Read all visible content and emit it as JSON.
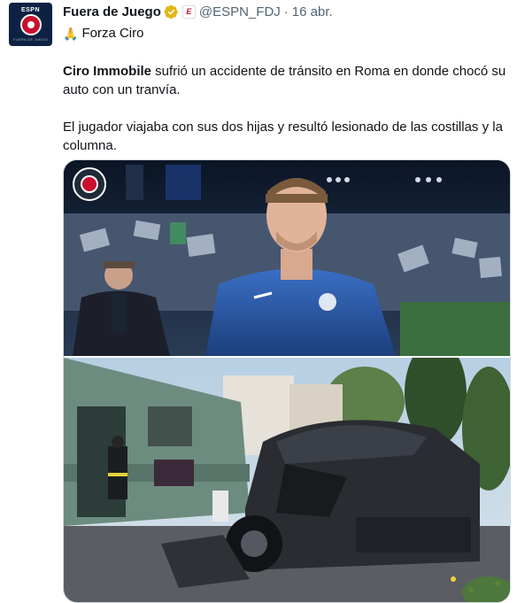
{
  "author": {
    "name": "Fuera de Juego",
    "handle": "@ESPN_FDJ",
    "separator": "·",
    "date": "16 abr.",
    "avatar_text": "ESPN",
    "avatar_subtext": "FUERA DE JUEGO",
    "affiliate_icon": "espn-e-badge-icon",
    "verified_icon": "verified-gold-badge-icon"
  },
  "tweet": {
    "first_line_emoji": "🙏",
    "first_line_text": "Forza Ciro",
    "paragraph1_bold": "Ciro Immobile",
    "paragraph1_rest": " sufrió un accidente de tránsito en Roma en donde chocó su auto con un tranvía.",
    "paragraph2": "El jugador viajaba con sus dos hijas y resultó lesionado de las costillas y la columna."
  },
  "media": {
    "top_photo": "footballer-in-blue-jacket-stadium-photo",
    "bottom_photo": "crashed-car-and-tram-street-photo"
  },
  "colors": {
    "text": "#0f1419",
    "muted": "#536471",
    "verified_gold": "#e2b719",
    "espn_red": "#c8102e",
    "border": "#cfd9de"
  }
}
